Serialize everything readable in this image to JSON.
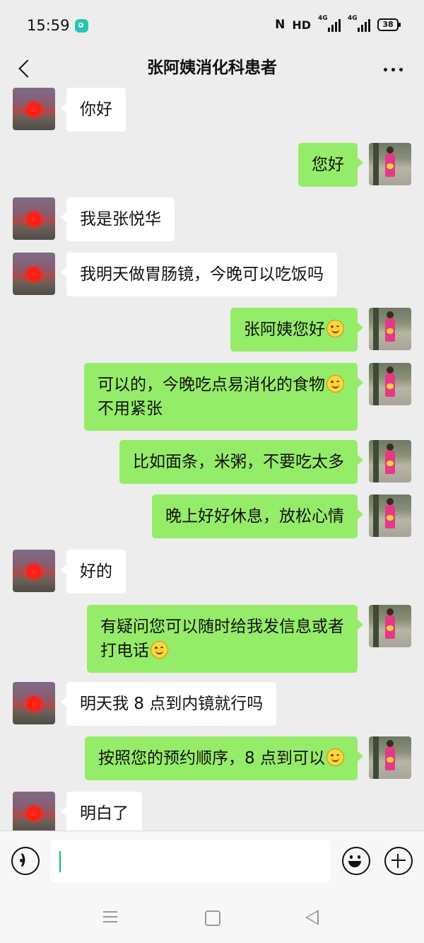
{
  "status_bar": {
    "time": "15:59",
    "network": "HD",
    "signal_1": "4G",
    "signal_2": "4G",
    "battery": "38"
  },
  "header": {
    "title": "张阿姨消化科患者"
  },
  "messages": [
    {
      "side": "in",
      "parts": [
        "你好"
      ]
    },
    {
      "side": "out",
      "parts": [
        "您好"
      ]
    },
    {
      "side": "in",
      "parts": [
        "我是张悦华"
      ]
    },
    {
      "side": "in",
      "parts": [
        "我明天做胃肠镜，今晚可以吃饭吗"
      ]
    },
    {
      "side": "out",
      "parts": [
        "张阿姨您好"
      ],
      "emoji": true
    },
    {
      "side": "out",
      "parts": [
        "可以的，今晚吃点易消化的食物",
        "不用紧张"
      ],
      "emoji_line": 0
    },
    {
      "side": "out",
      "parts": [
        "比如面条，米粥，不要吃太多"
      ]
    },
    {
      "side": "out",
      "parts": [
        "晚上好好休息，放松心情"
      ]
    },
    {
      "side": "in",
      "parts": [
        "好的"
      ]
    },
    {
      "side": "out",
      "parts": [
        "有疑问您可以随时给我发信息或者",
        "打电话"
      ],
      "emoji_line": 1
    },
    {
      "side": "in",
      "parts": [
        "明天我 8 点到内镜就行吗"
      ]
    },
    {
      "side": "out",
      "parts": [
        "按照您的预约顺序，8 点到可以"
      ],
      "emoji": true
    },
    {
      "side": "in",
      "parts": [
        "明白了"
      ]
    }
  ],
  "input": {
    "value": ""
  },
  "icons": {
    "back": "chevron-left-icon",
    "more": "more-icon",
    "voice": "voice-icon",
    "emoji": "emoji-icon",
    "plus": "plus-icon"
  },
  "colors": {
    "outgoing_bubble": "#95ec69",
    "incoming_bubble": "#ffffff",
    "background": "#ededed",
    "cursor": "#07c160"
  }
}
